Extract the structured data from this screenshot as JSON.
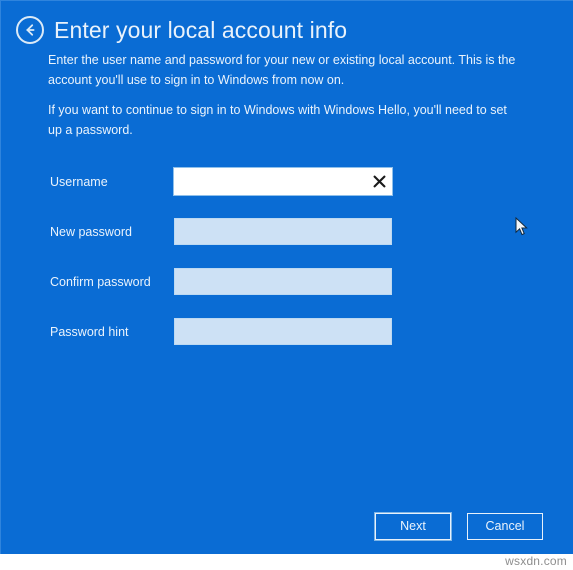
{
  "colors": {
    "background_blue": "#0a6cd4",
    "text_light": "#eaf3fc",
    "field_inactive": "#cde1f5",
    "field_active": "#ffffff",
    "clear_icon": "#1a1a1a",
    "watermark": "#8e8e8e"
  },
  "header": {
    "back_icon": "back-arrow-circle-icon",
    "title": "Enter your local account info"
  },
  "body": {
    "paragraph_1": "Enter the user name and password for your new or existing local account. This is the account you'll use to sign in to Windows from now on.",
    "paragraph_2": "If you want to continue to sign in to Windows with Windows Hello, you'll need to set up a password."
  },
  "form": {
    "fields": [
      {
        "label": "Username",
        "value": "",
        "placeholder": "",
        "type": "text",
        "state": "focused",
        "has_clear_button": true,
        "clear_icon": "close-x-icon"
      },
      {
        "label": "New password",
        "value": "",
        "placeholder": "",
        "type": "password",
        "state": "default",
        "has_clear_button": false
      },
      {
        "label": "Confirm password",
        "value": "",
        "placeholder": "",
        "type": "password",
        "state": "default",
        "has_clear_button": false
      },
      {
        "label": "Password hint",
        "value": "",
        "placeholder": "",
        "type": "text",
        "state": "default",
        "has_clear_button": false
      }
    ]
  },
  "footer": {
    "next_label": "Next",
    "cancel_label": "Cancel"
  },
  "overlay": {
    "cursor_icon": "mouse-pointer-icon",
    "watermark": "wsxdn.com"
  }
}
